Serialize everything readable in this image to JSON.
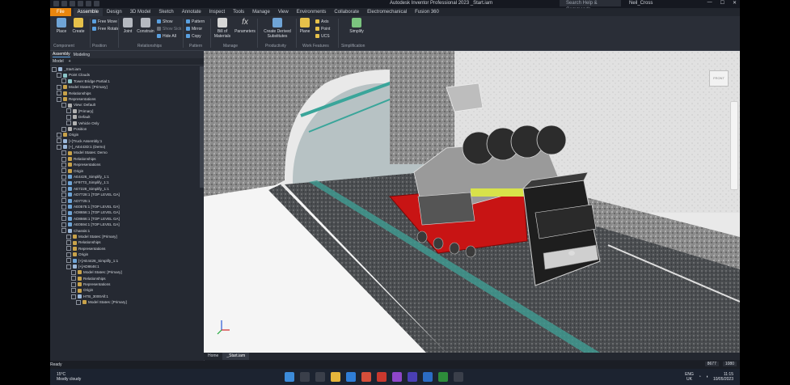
{
  "title_bar": {
    "app_title": "Autodesk Inventor Professional 2023   _Start.iam",
    "search_placeholder": "Search Help & Commands...",
    "user": "Neil_Cross",
    "window_controls": [
      "—",
      "☐",
      "✕"
    ]
  },
  "menu": {
    "file": "File",
    "tabs": [
      "Assemble",
      "Design",
      "3D Model",
      "Sketch",
      "Annotate",
      "Inspect",
      "Tools",
      "Manage",
      "View",
      "Environments",
      "Collaborate",
      "Electromechanical",
      "Fusion 360"
    ],
    "active_index": 0
  },
  "ribbon": {
    "large_buttons": [
      {
        "label": "Place",
        "color": "#6fa4d6"
      },
      {
        "label": "Create",
        "color": "#e6c14a"
      },
      {
        "label": "Joint",
        "color": "#b5b9c0"
      },
      {
        "label": "Constrain",
        "color": "#b5b9c0"
      },
      {
        "label": "Bill of Materials",
        "color": "#d6d6d6"
      },
      {
        "label": "Parameters",
        "color": "#d6d6d6"
      },
      {
        "label": "Create Derived Substitutes",
        "color": "#6fa4d6"
      },
      {
        "label": "Plane",
        "color": "#e6c14a"
      },
      {
        "label": "Simplify",
        "color": "#7bc47f"
      }
    ],
    "small_buttons": {
      "position": [
        "Free Move",
        "Free Rotate"
      ],
      "relationships": [
        "Show",
        "Show Sick",
        "Hide All"
      ],
      "pattern": [
        "Pattern",
        "Mirror",
        "Copy"
      ],
      "work_features": [
        "Axis",
        "Point",
        "UCS"
      ]
    },
    "groups": [
      "Component",
      "Position",
      "Relationships",
      "Pattern",
      "Manage",
      "Productivity",
      "Work Features",
      "Simplification"
    ]
  },
  "browser": {
    "tabs": [
      "Assembly",
      "Modeling"
    ],
    "header": "Model",
    "nodes": [
      {
        "label": "_Start.iam",
        "depth": 0,
        "icon": "asm"
      },
      {
        "label": "Point Clouds",
        "depth": 1,
        "icon": "cloud"
      },
      {
        "label": "Tower Bridge Partial:1",
        "depth": 2,
        "icon": "cloud"
      },
      {
        "label": "Model States: [Primary]",
        "depth": 1,
        "icon": "folder"
      },
      {
        "label": "Relationships",
        "depth": 1,
        "icon": "folder"
      },
      {
        "label": "Representations",
        "depth": 1,
        "icon": "folder"
      },
      {
        "label": "View: Default",
        "depth": 2,
        "icon": "view"
      },
      {
        "label": "[Primary]",
        "depth": 3,
        "icon": "view"
      },
      {
        "label": "Default",
        "depth": 3,
        "icon": "view"
      },
      {
        "label": "Vehicle Only",
        "depth": 3,
        "icon": "view"
      },
      {
        "label": "Position",
        "depth": 2,
        "icon": "view"
      },
      {
        "label": "Origin",
        "depth": 1,
        "icon": "folder"
      },
      {
        "label": "[+]Truck Assembly:1",
        "depth": 1,
        "icon": "asm"
      },
      {
        "label": "[+]_AE443D:1 (Demo)",
        "depth": 1,
        "icon": "asm"
      },
      {
        "label": "Model States: Demo",
        "depth": 2,
        "icon": "folder"
      },
      {
        "label": "Relationships",
        "depth": 2,
        "icon": "folder"
      },
      {
        "label": "Representations",
        "depth": 2,
        "icon": "folder"
      },
      {
        "label": "Origin",
        "depth": 2,
        "icon": "folder"
      },
      {
        "label": "AE4426_Simplify_1:1",
        "depth": 2,
        "icon": "part"
      },
      {
        "label": "AF9773_Simplify_1:1",
        "depth": 2,
        "icon": "part"
      },
      {
        "label": "AE7228_Simplify_1:1",
        "depth": 2,
        "icon": "part"
      },
      {
        "label": "AD7728:1 [TOP LEVEL GA]",
        "depth": 2,
        "icon": "part"
      },
      {
        "label": "AD7725:1",
        "depth": 2,
        "icon": "part"
      },
      {
        "label": "AE0575:1 [TOP LEVEL GA]",
        "depth": 2,
        "icon": "part"
      },
      {
        "label": "AD8656:1 [TOP LEVEL GA]",
        "depth": 2,
        "icon": "part"
      },
      {
        "label": "AD8666:1 [TOP LEVEL GA]",
        "depth": 2,
        "icon": "part"
      },
      {
        "label": "AE0594:1 [TOP LEVEL GA]",
        "depth": 2,
        "icon": "part"
      },
      {
        "label": "Chassis:1",
        "depth": 2,
        "icon": "asm"
      },
      {
        "label": "Model States: [Primary]",
        "depth": 3,
        "icon": "folder"
      },
      {
        "label": "Relationships",
        "depth": 3,
        "icon": "folder"
      },
      {
        "label": "Representations",
        "depth": 3,
        "icon": "folder"
      },
      {
        "label": "Origin",
        "depth": 3,
        "icon": "folder"
      },
      {
        "label": "[+]AE4426_Simplify_1:1",
        "depth": 3,
        "icon": "part"
      },
      {
        "label": "[+]AD8646:1",
        "depth": 3,
        "icon": "asm"
      },
      {
        "label": "Model States: [Primary]",
        "depth": 4,
        "icon": "folder"
      },
      {
        "label": "Relationships",
        "depth": 4,
        "icon": "folder"
      },
      {
        "label": "Representations",
        "depth": 4,
        "icon": "folder"
      },
      {
        "label": "Origin",
        "depth": 4,
        "icon": "folder"
      },
      {
        "label": "HTB_3000All:1",
        "depth": 4,
        "icon": "asm"
      },
      {
        "label": "Model States: [Primary]",
        "depth": 5,
        "icon": "folder"
      }
    ]
  },
  "viewport": {
    "viewcube_label": "FRONT",
    "colors": {
      "trailer_bed": "#c81414",
      "truck_outline": "#d0d0d0",
      "cloud_bg": "#e4e4e4"
    }
  },
  "doc_tabs": [
    "Home",
    "_Start.iam"
  ],
  "status": {
    "ready": "Ready",
    "counts": [
      "8677",
      "1080"
    ]
  },
  "taskbar": {
    "temperature": "15°C",
    "weather": "Mostly cloudy",
    "lang": "ENG",
    "region": "UK",
    "time": "11:15",
    "date": "10/05/2023"
  }
}
